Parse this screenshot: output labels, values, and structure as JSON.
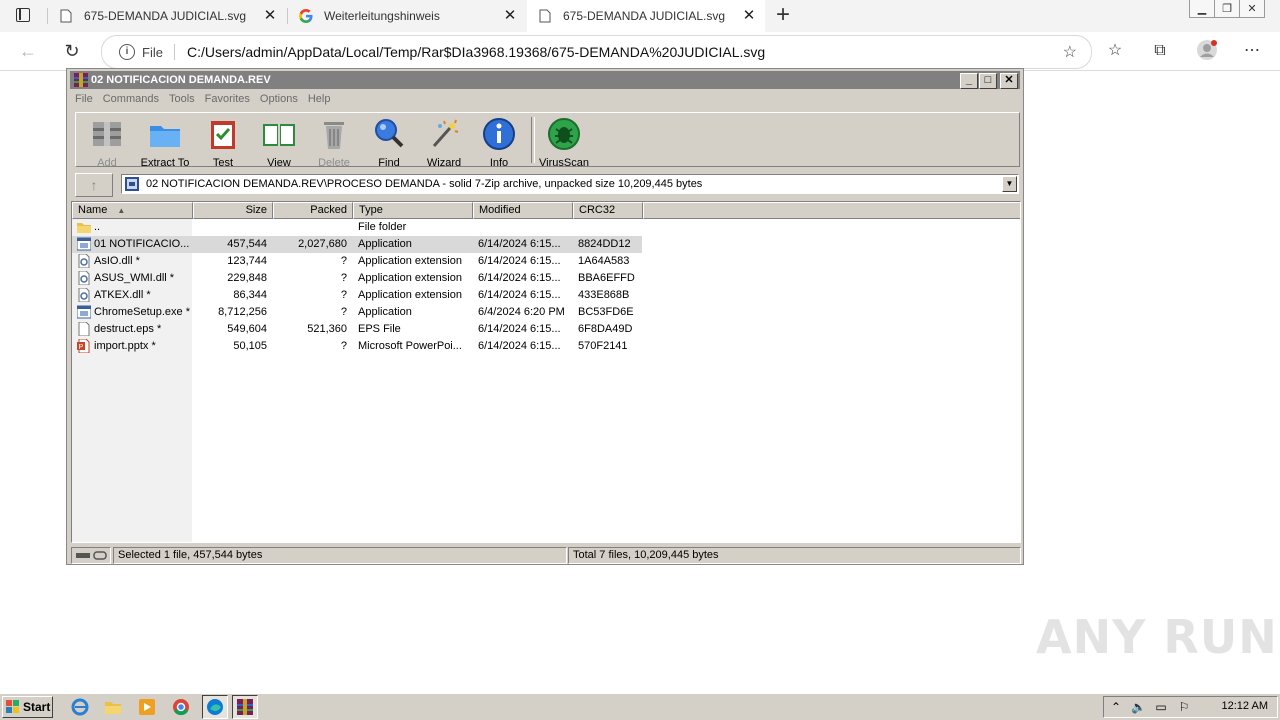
{
  "browser": {
    "tabs": [
      {
        "label": "675-DEMANDA JUDICIAL.svg",
        "icon": "page-icon"
      },
      {
        "label": "Weiterleitungshinweis",
        "icon": "google-icon"
      },
      {
        "label": "675-DEMANDA JUDICIAL.svg",
        "icon": "page-icon"
      }
    ],
    "new_tab_glyph": "+",
    "file_label": "File",
    "url": "C:/Users/admin/AppData/Local/Temp/Rar$DIa3968.19368/675-DEMANDA%20JUDICIAL.svg"
  },
  "winrar": {
    "title": "02 NOTIFICACION DEMANDA.REV",
    "menu": [
      "File",
      "Commands",
      "Tools",
      "Favorites",
      "Options",
      "Help"
    ],
    "toolbar": {
      "add": "Add",
      "extract": "Extract To",
      "test": "Test",
      "view": "View",
      "delete": "Delete",
      "find": "Find",
      "wizard": "Wizard",
      "info": "Info",
      "virusscan": "VirusScan"
    },
    "path": "02 NOTIFICACION DEMANDA.REV\\PROCESO DEMANDA - solid 7-Zip archive, unpacked size 10,209,445 bytes",
    "columns": {
      "name": "Name",
      "size": "Size",
      "packed": "Packed",
      "type": "Type",
      "modified": "Modified",
      "crc": "CRC32"
    },
    "files": [
      {
        "name": "..",
        "size": "",
        "packed": "",
        "type": "File folder",
        "modified": "",
        "crc": "",
        "icon": "folder-icon"
      },
      {
        "name": "01 NOTIFICACIO...",
        "size": "457,544",
        "packed": "2,027,680",
        "type": "Application",
        "modified": "6/14/2024 6:15...",
        "crc": "8824DD12",
        "icon": "exe-icon"
      },
      {
        "name": "AsIO.dll *",
        "size": "123,744",
        "packed": "?",
        "type": "Application extension",
        "modified": "6/14/2024 6:15...",
        "crc": "1A64A583",
        "icon": "dll-icon"
      },
      {
        "name": "ASUS_WMI.dll *",
        "size": "229,848",
        "packed": "?",
        "type": "Application extension",
        "modified": "6/14/2024 6:15...",
        "crc": "BBA6EFFD",
        "icon": "dll-icon"
      },
      {
        "name": "ATKEX.dll *",
        "size": "86,344",
        "packed": "?",
        "type": "Application extension",
        "modified": "6/14/2024 6:15...",
        "crc": "433E868B",
        "icon": "dll-icon"
      },
      {
        "name": "ChromeSetup.exe *",
        "size": "8,712,256",
        "packed": "?",
        "type": "Application",
        "modified": "6/4/2024 6:20 PM",
        "crc": "BC53FD6E",
        "icon": "exe-icon"
      },
      {
        "name": "destruct.eps *",
        "size": "549,604",
        "packed": "521,360",
        "type": "EPS File",
        "modified": "6/14/2024 6:15...",
        "crc": "6F8DA49D",
        "icon": "file-icon"
      },
      {
        "name": "import.pptx *",
        "size": "50,105",
        "packed": "?",
        "type": "Microsoft PowerPoi...",
        "modified": "6/14/2024 6:15...",
        "crc": "570F2141",
        "icon": "pptx-icon"
      }
    ],
    "status_left": "Selected 1 file, 457,544 bytes",
    "status_right": "Total 7 files, 10,209,445 bytes"
  },
  "watermark": "ANY RUN",
  "taskbar": {
    "start": "Start",
    "clock": "12:12 AM"
  }
}
